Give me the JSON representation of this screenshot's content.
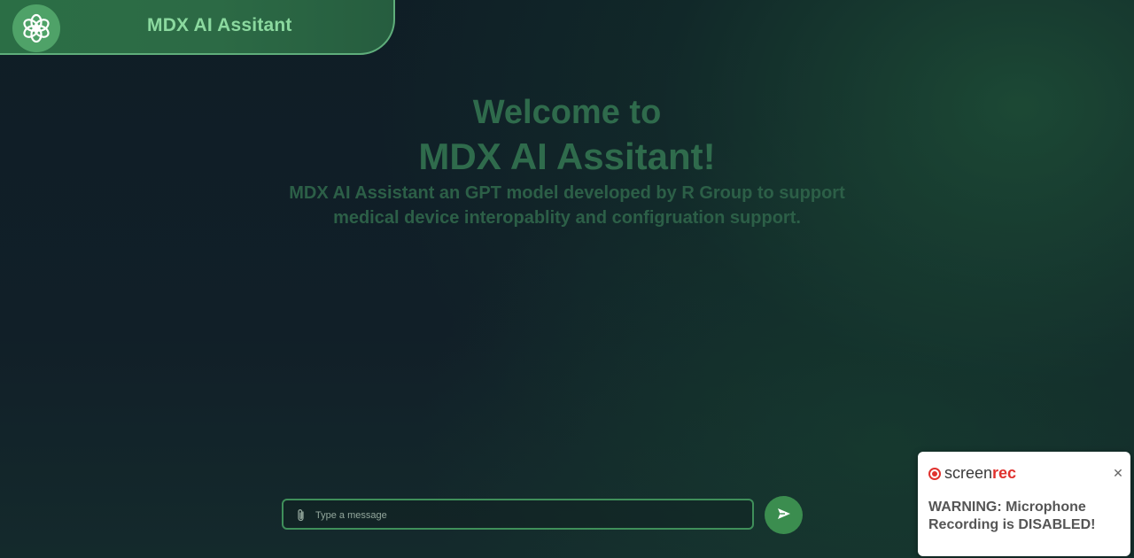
{
  "header": {
    "title": "MDX AI Assitant",
    "logo_icon": "openai-logo-icon"
  },
  "welcome": {
    "line1": "Welcome to",
    "line2": "MDX AI Assitant!",
    "description": "MDX AI Assistant an GPT model developed by R Group to support medical device interopablity and configruation support."
  },
  "composer": {
    "placeholder": "Type a message",
    "value": "",
    "attach_icon": "paperclip-icon",
    "send_icon": "send-icon"
  },
  "toast": {
    "brand_part1": "screen",
    "brand_part2": "rec",
    "message": "WARNING: Microphone Recording is DISABLED!",
    "close_icon": "close-icon"
  },
  "colors": {
    "accent": "#3b8d4f",
    "header_title": "#8bd99f",
    "welcome_text": "#2f6b4c",
    "rec_red": "#e0322e"
  }
}
